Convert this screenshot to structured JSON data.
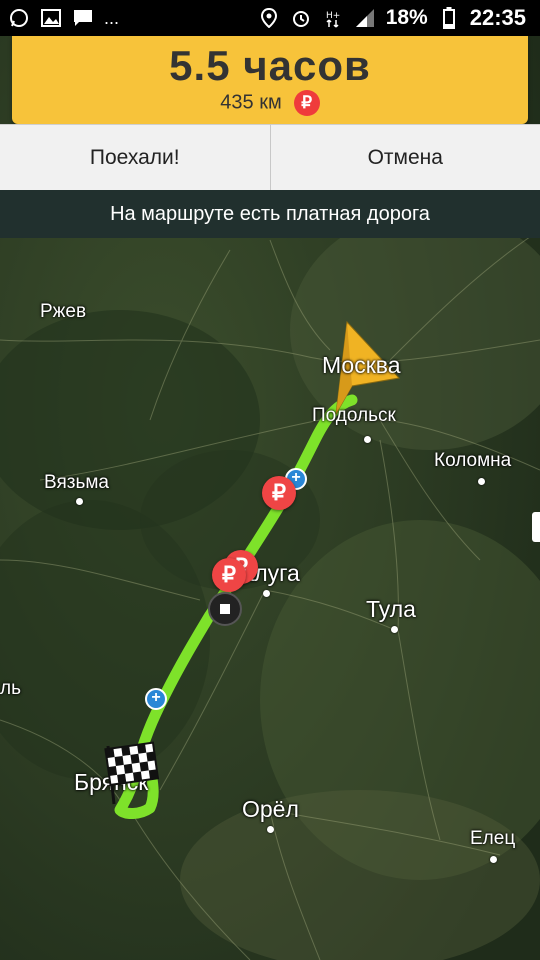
{
  "status_bar": {
    "left_icons": [
      "whatsapp-icon",
      "gallery-icon",
      "message-icon",
      "more-dots"
    ],
    "more": "...",
    "battery": "18%",
    "time": "22:35"
  },
  "route": {
    "duration": "5.5 часов",
    "distance": "435 км",
    "toll_symbol": "₽"
  },
  "buttons": {
    "go": "Поехали!",
    "cancel": "Отмена"
  },
  "notice": "На маршруте есть платная дорога",
  "map": {
    "cities": {
      "rzhev": "Ржев",
      "moscow": "Москва",
      "podolsk": "Подольск",
      "kolomna": "Коломна",
      "vyazma": "Вязьма",
      "kaluga": "Калуга",
      "tula": "Тула",
      "bryansk": "Брянск",
      "orel": "Орёл",
      "elets": "Елец",
      "partial_left": "ль"
    },
    "toll_symbol": "₽",
    "colors": {
      "route": "#7ee22a",
      "toll": "#ef4545",
      "accent": "#f7c33a"
    }
  }
}
